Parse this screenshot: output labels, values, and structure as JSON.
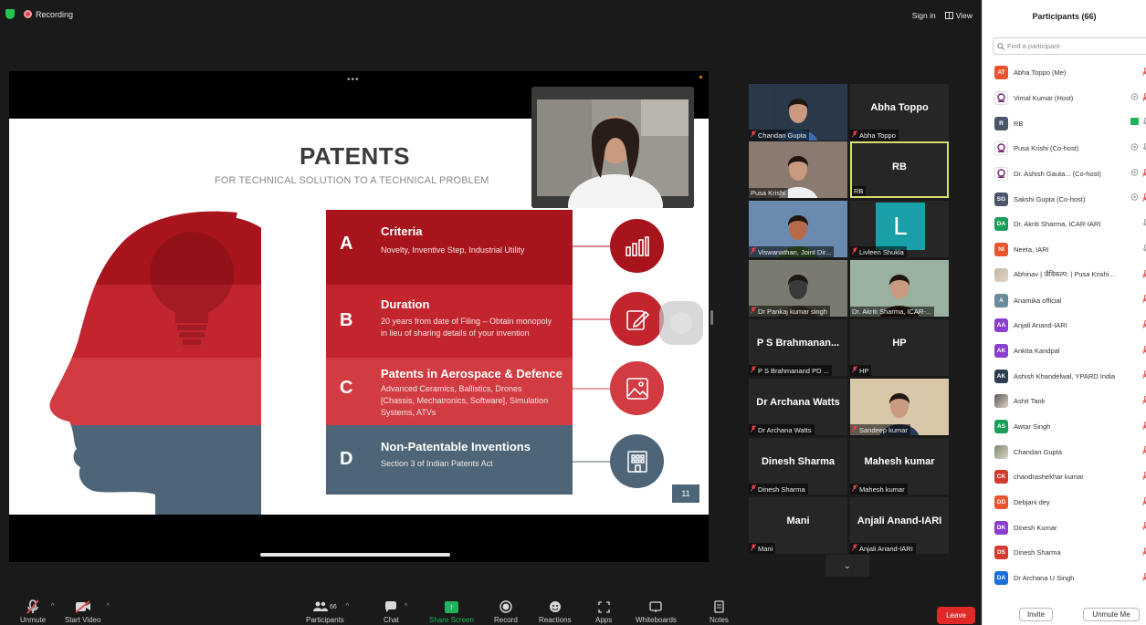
{
  "topbar": {
    "recording_label": "Recording",
    "sign_in_label": "Sign in",
    "view_label": "View"
  },
  "slide": {
    "title": "PATENTS",
    "subtitle": "FOR TECHNICAL SOLUTION TO A TECHNICAL PROBLEM",
    "rows": [
      {
        "letter": "A",
        "title": "Criteria",
        "desc": "Novelty, Inventive Step, Industrial Utility",
        "color": "#a8141c"
      },
      {
        "letter": "B",
        "title": "Duration",
        "desc": "20 years from date of Filing – Obtain monopoly in lieu of sharing details of your invention",
        "color": "#c2252e"
      },
      {
        "letter": "C",
        "title": "Patents in Aerospace & Defence",
        "desc": "Advanced Ceramics, Ballistics, Drones [Chassis, Mechatronics, Software], Simulation Systems, ATVs",
        "color": "#d23b42"
      },
      {
        "letter": "D",
        "title": "Non-Patentable Inventions",
        "desc": "Section 3 of Indian Patents Act",
        "color": "#4d6577"
      }
    ],
    "page_number": "11"
  },
  "gallery": {
    "tiles": [
      {
        "name": "",
        "label": "Chandan Gupta",
        "type": "photo",
        "muted": true
      },
      {
        "name": "Abha Toppo",
        "label": "Abha Toppo",
        "type": "name",
        "muted": true
      },
      {
        "name": "",
        "label": "Pusa Krishi",
        "type": "photo",
        "muted": false
      },
      {
        "name": "RB",
        "label": "RB",
        "type": "name",
        "muted": false,
        "active": true
      },
      {
        "name": "",
        "label": "Viswanathan, Joint Dir...",
        "type": "photo",
        "muted": true
      },
      {
        "name": "L",
        "label": "Livleen Shukla",
        "type": "letter",
        "muted": true
      },
      {
        "name": "",
        "label": "Dr Pankaj kumar singh",
        "type": "photo",
        "muted": true
      },
      {
        "name": "",
        "label": "Dr. Akriti Sharma, ICAR-...",
        "type": "photo",
        "muted": false
      },
      {
        "name": "P S Brahmanan...",
        "label": "P S Brahmanand PD ...",
        "type": "name",
        "muted": true
      },
      {
        "name": "HP",
        "label": "HP",
        "type": "name",
        "muted": true
      },
      {
        "name": "Dr Archana Watts",
        "label": "Dr Archana Watts",
        "type": "name",
        "muted": true
      },
      {
        "name": "",
        "label": "Sandeep kumar",
        "type": "photo",
        "muted": true
      },
      {
        "name": "Dinesh Sharma",
        "label": "Dinesh Sharma",
        "type": "name",
        "muted": true
      },
      {
        "name": "Mahesh kumar",
        "label": "Mahesh kumar",
        "type": "name",
        "muted": true
      },
      {
        "name": "Mani",
        "label": "Mani",
        "type": "name",
        "muted": true
      },
      {
        "name": "Anjali Anand-IARI",
        "label": "Anjali Anand-IARI",
        "type": "name",
        "muted": true
      }
    ]
  },
  "toolbar": {
    "unmute": "Unmute",
    "start_video": "Start Video",
    "participants": "Participants",
    "participants_count": "66",
    "chat": "Chat",
    "share_screen": "Share Screen",
    "record": "Record",
    "reactions": "Reactions",
    "apps": "Apps",
    "whiteboards": "Whiteboards",
    "notes": "Notes",
    "leave": "Leave"
  },
  "panel": {
    "title": "Participants (66)",
    "search_placeholder": "Find a participant",
    "participants": [
      {
        "initials": "AT",
        "name": "Abha Toppo (Me)",
        "color": "#e8542b",
        "kind": "initials",
        "icons": [
          "mute"
        ]
      },
      {
        "initials": "",
        "name": "Vimal Kumar (Host)",
        "color": "#ffffff",
        "kind": "logo",
        "icons": [
          "cam",
          "mute"
        ]
      },
      {
        "initials": "R",
        "name": "RB",
        "color": "#4a5568",
        "kind": "initials",
        "icons": [
          "green",
          "mic"
        ]
      },
      {
        "initials": "",
        "name": "Pusa Krishi (Co-host)",
        "color": "#ffffff",
        "kind": "logo",
        "icons": [
          "cam",
          "mic"
        ]
      },
      {
        "initials": "",
        "name": "Dr. Ashish Gauta... (Co-host)",
        "color": "#ffffff",
        "kind": "logo",
        "icons": [
          "cam",
          "mute"
        ]
      },
      {
        "initials": "SG",
        "name": "Sakshi Gupta (Co-host)",
        "color": "#4a5568",
        "kind": "initials",
        "icons": [
          "cam",
          "mute"
        ]
      },
      {
        "initials": "DA",
        "name": "Dr. Akriti Sharma, ICAR-IARI",
        "color": "#18a05b",
        "kind": "initials",
        "icons": [
          "mic"
        ]
      },
      {
        "initials": "NI",
        "name": "Neeta, IARI",
        "color": "#e8542b",
        "kind": "initials",
        "icons": [
          "mic"
        ]
      },
      {
        "initials": "",
        "name": "Abhinav | जैविकल्प: | Pusa Krishi...",
        "color": "#c8b7a4",
        "kind": "photo",
        "icons": [
          "mute"
        ]
      },
      {
        "initials": "A",
        "name": "Anamika official",
        "color": "#6b8a9a",
        "kind": "initials",
        "icons": [
          "mute"
        ]
      },
      {
        "initials": "AA",
        "name": "Anjali Anand-IARI",
        "color": "#8a3fcf",
        "kind": "initials",
        "icons": [
          "mute"
        ]
      },
      {
        "initials": "AK",
        "name": "Ankita Kandpal",
        "color": "#8a3fcf",
        "kind": "initials",
        "icons": [
          "mute"
        ]
      },
      {
        "initials": "AK",
        "name": "Ashish Khandelwal, YPARD India",
        "color": "#2f3e4e",
        "kind": "initials",
        "icons": [
          "mute"
        ]
      },
      {
        "initials": "",
        "name": "Ashit Tank",
        "color": "#555555",
        "kind": "photo",
        "icons": [
          "mute"
        ]
      },
      {
        "initials": "AS",
        "name": "Awtar Singh",
        "color": "#18a05b",
        "kind": "initials",
        "icons": [
          "mute"
        ]
      },
      {
        "initials": "",
        "name": "Chandan Gupta",
        "color": "#7a8a6a",
        "kind": "photo",
        "icons": [
          "mute"
        ]
      },
      {
        "initials": "CK",
        "name": "chandrashekhar kumar",
        "color": "#d33b2f",
        "kind": "initials",
        "icons": [
          "mute"
        ]
      },
      {
        "initials": "DD",
        "name": "Debjani dey",
        "color": "#e8542b",
        "kind": "initials",
        "icons": [
          "mute"
        ]
      },
      {
        "initials": "DK",
        "name": "Dinesh Kumar",
        "color": "#8a3fcf",
        "kind": "initials",
        "icons": [
          "mute"
        ]
      },
      {
        "initials": "DS",
        "name": "Dinesh Sharma",
        "color": "#d33b2f",
        "kind": "initials",
        "icons": [
          "mute"
        ]
      },
      {
        "initials": "DA",
        "name": "Dr Archana U Singh",
        "color": "#1b6fd8",
        "kind": "initials",
        "icons": [
          "mute"
        ]
      }
    ],
    "invite": "Invite",
    "unmute_me": "Unmute Me"
  }
}
